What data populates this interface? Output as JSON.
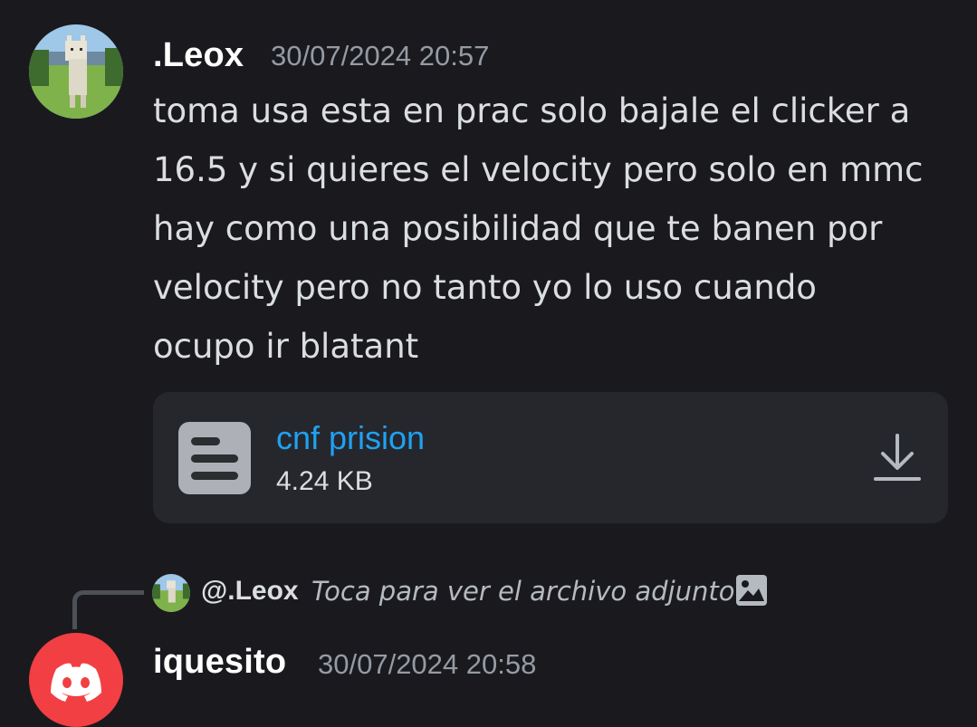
{
  "messages": [
    {
      "author": ".Leox",
      "timestamp": "30/07/2024 20:57",
      "lines": [
        "toma usa esta en prac solo bajale el clicker a",
        "16.5 y si quieres el velocity pero solo en mmc",
        "hay como una posibilidad que te banen por",
        "velocity pero no tanto yo lo uso cuando",
        "ocupo ir blatant"
      ],
      "avatar_icon": "llama-avatar",
      "attachment": {
        "file_name": "cnf prision",
        "file_size": "4.24 KB",
        "icon": "document-icon",
        "action_icon": "download-icon"
      }
    },
    {
      "author": "iquesito",
      "timestamp": "30/07/2024 20:58",
      "avatar_icon": "discord-logo-avatar",
      "avatar_color": "#f23f43",
      "reply": {
        "author": "@.Leox",
        "text": "Toca para ver el archivo adjunto",
        "icon": "image-icon"
      }
    }
  ],
  "colors": {
    "background": "#1a1a1e",
    "attachment_bg": "#26272d",
    "link": "#1ea2f2",
    "muted": "#949ba4"
  }
}
